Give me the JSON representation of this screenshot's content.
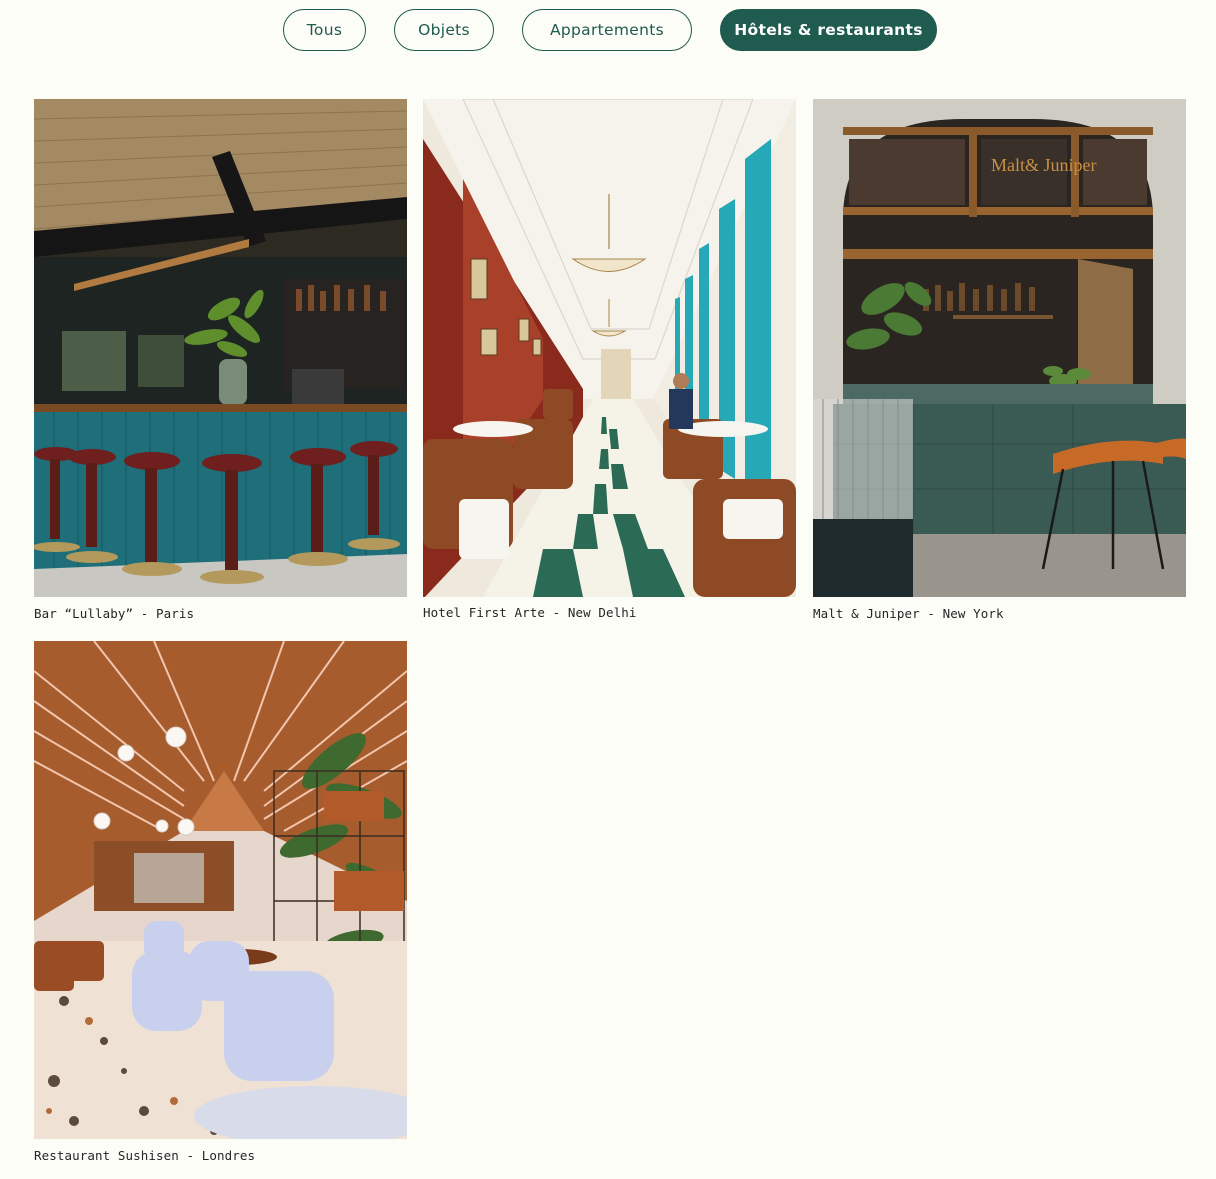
{
  "filters": [
    {
      "label": "Tous",
      "active": false
    },
    {
      "label": "Objets",
      "active": false
    },
    {
      "label": "Appartements",
      "active": false
    },
    {
      "label": "Hôtels & restaurants",
      "active": true
    }
  ],
  "gallery": [
    {
      "caption": "Bar “Lullaby” - Paris",
      "image": "bar-interior-teal-counter"
    },
    {
      "caption": "Hotel First Arte - New Delhi",
      "image": "hotel-dining-checkered-floor"
    },
    {
      "caption": "Malt & Juniper - New York",
      "image": "bar-window-green-marble"
    },
    {
      "caption": "Restaurant Sushisen - Londres",
      "image": "restaurant-wooden-roof-terrazzo"
    }
  ],
  "signage": {
    "window_sign": "Malt& Juniper"
  },
  "colors": {
    "accent": "#1f5b4f",
    "background": "#fdfdf8",
    "text": "#262626"
  }
}
